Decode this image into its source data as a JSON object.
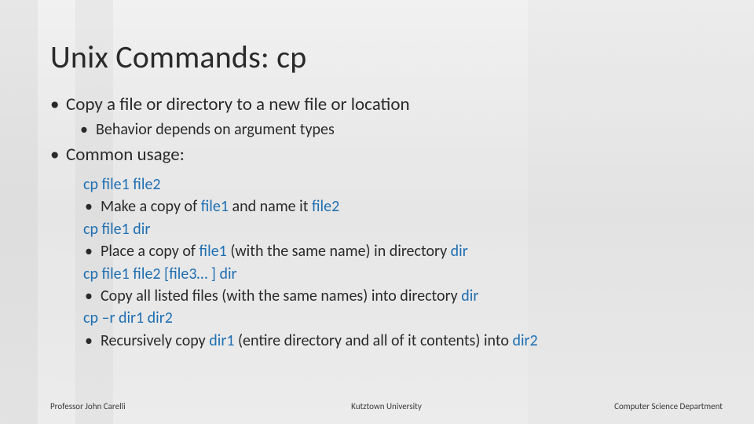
{
  "title": "Unix Commands: cp",
  "bullets": {
    "b1": "Copy a file or directory to a new file or location",
    "b1_sub1": "Behavior depends on argument types",
    "b2": "Common usage:"
  },
  "usage": {
    "u1_cmd": "cp file1 file2",
    "u1_desc_pre": "Make a copy of ",
    "u1_arg1": "file1",
    "u1_mid": " and name it ",
    "u1_arg2": "file2",
    "u2_cmd": "cp file1 dir",
    "u2_desc_pre": "Place a copy of ",
    "u2_arg1": "file1",
    "u2_mid": " (with the same name) in directory ",
    "u2_arg2": "dir",
    "u3_cmd": "cp file1 file2 [file3… ] dir",
    "u3_desc_pre": "Copy all listed files (with the same names) into directory ",
    "u3_arg1": "dir",
    "u4_cmd": "cp –r dir1 dir2",
    "u4_desc_pre": "Recursively copy ",
    "u4_arg1": "dir1",
    "u4_mid": " (entire directory and all of it contents) into ",
    "u4_arg2": "dir2"
  },
  "footer": {
    "left": "Professor John Carelli",
    "center": "Kutztown University",
    "right": "Computer Science Department"
  }
}
